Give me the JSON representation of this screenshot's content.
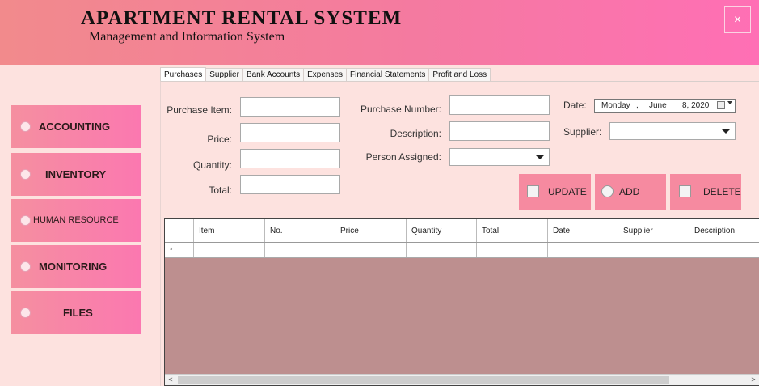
{
  "header": {
    "title": "APARTMENT RENTAL SYSTEM",
    "subtitle": "Management and Information System",
    "close_label": "×"
  },
  "sidebar": {
    "items": [
      {
        "label": "ACCOUNTING",
        "icon": "app-icon"
      },
      {
        "label": "INVENTORY",
        "icon": "app-icon"
      },
      {
        "label": "HUMAN RESOURCE",
        "icon": "app-icon"
      },
      {
        "label": "MONITORING",
        "icon": "app-icon"
      },
      {
        "label": "FILES",
        "icon": "app-icon"
      }
    ]
  },
  "tabs": [
    {
      "label": "Purchases",
      "active": true
    },
    {
      "label": "Supplier"
    },
    {
      "label": "Bank Accounts"
    },
    {
      "label": "Expenses"
    },
    {
      "label": "Financial Statements"
    },
    {
      "label": "Profit and Loss"
    }
  ],
  "form": {
    "purchase_item_label": "Purchase Item:",
    "price_label": "Price:",
    "quantity_label": "Quantity:",
    "total_label": "Total:",
    "purchase_number_label": "Purchase Number:",
    "description_label": "Description:",
    "person_assigned_label": "Person Assigned:",
    "date_label": "Date:",
    "supplier_label": "Supplier:",
    "purchase_item_value": "",
    "price_value": "",
    "quantity_value": "",
    "total_value": "",
    "purchase_number_value": "",
    "description_value": "",
    "person_assigned_value": "",
    "supplier_value": "",
    "date": {
      "day": "Monday",
      "sep": ",",
      "month": "June",
      "daynum_year": "8, 2020"
    }
  },
  "actions": {
    "update_label": "UPDATE",
    "add_label": "ADD",
    "delete_label": "DELETE"
  },
  "grid": {
    "columns": [
      "Item",
      "No.",
      "Price",
      "Quantity",
      "Total",
      "Date",
      "Supplier",
      "Description"
    ],
    "new_row_marker": "*",
    "scroll_left": "<",
    "scroll_right": ">"
  },
  "colors": {
    "header_gradient_start": "#f28a8c",
    "header_gradient_end": "#ff6fb5",
    "background": "#fde2df",
    "button": "#f68aa0",
    "grid_empty": "#bd8f8f"
  }
}
